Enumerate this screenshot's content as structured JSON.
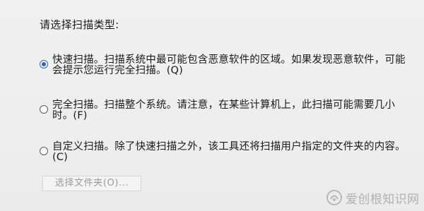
{
  "dialog": {
    "prompt": "请选择扫描类型:"
  },
  "options": [
    {
      "selected": true,
      "line1": "快速扫描。扫描系统中最可能包含恶意软件的区域。如果发现恶意软件，可能",
      "line2": "会提示您运行完全扫描。(Q)"
    },
    {
      "selected": false,
      "line1": "完全扫描。扫描整个系统。请注意，在某些计算机上，此扫描可能需要几小",
      "line2": "时。(F)"
    },
    {
      "selected": false,
      "line1": "自定义扫描。除了快速扫描之外，该工具还将扫描用户指定的文件夹的内容。",
      "line2": "(C)"
    }
  ],
  "folder_button": {
    "label": "选择文件夹(O)...",
    "enabled": false
  },
  "watermark": {
    "text": "爱创根知识网"
  },
  "colors": {
    "radio_selected": "#2a67c4",
    "background": "#eeeeee",
    "disabled_text": "#9a9a9a"
  }
}
